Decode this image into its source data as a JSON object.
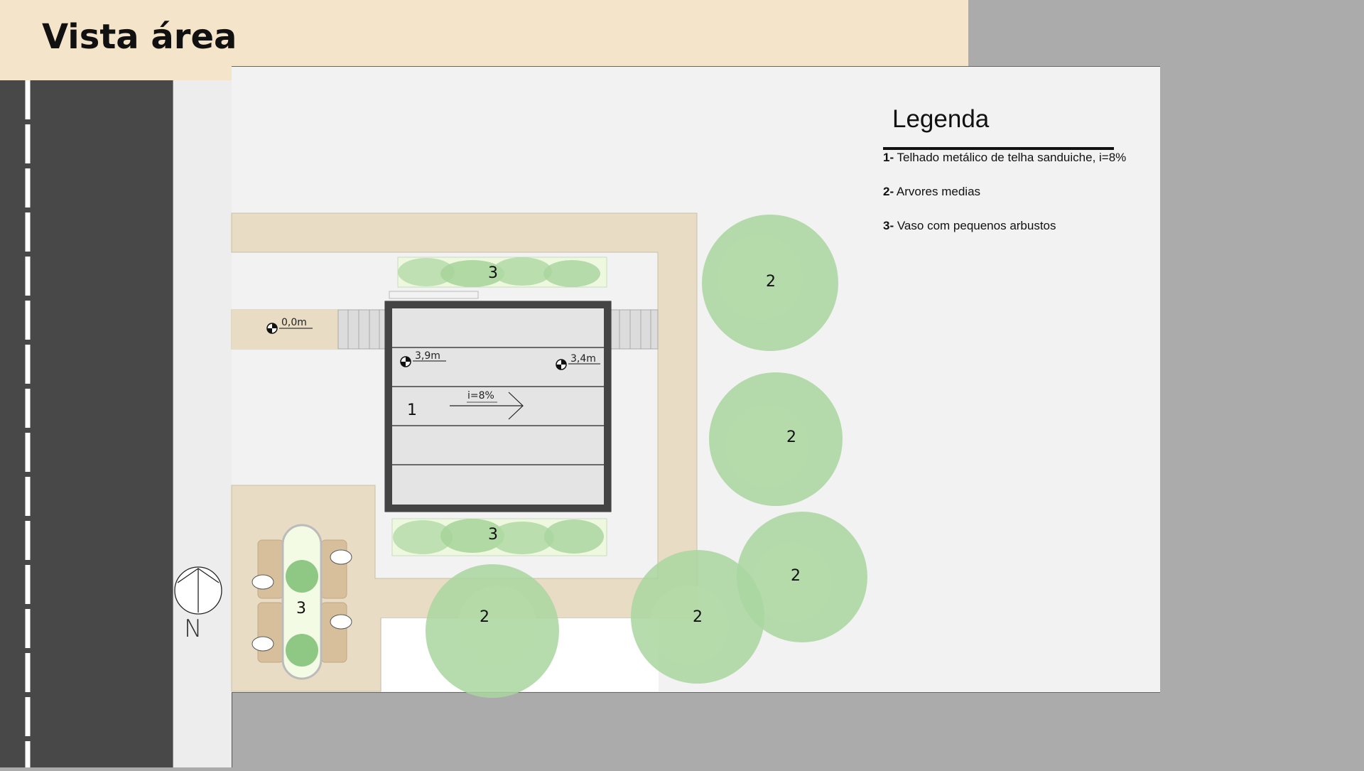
{
  "title": "Vista área",
  "legend": {
    "title": "Legenda",
    "items": [
      {
        "num": "1-",
        "text": "Telhado metálico de telha sanduiche, i=8%"
      },
      {
        "num": "2-",
        "text": "Arvores medias"
      },
      {
        "num": "3-",
        "text": "Vaso com pequenos arbustos"
      }
    ]
  },
  "plan": {
    "levels": [
      "0,0m",
      "3,9m",
      "3,4m"
    ],
    "slope": "i=8%",
    "roof_label": "1",
    "tree_label": "2",
    "planter_label": "3",
    "north": "N"
  },
  "colors": {
    "header_bg": "#f4e4ca",
    "road": "#484848",
    "paving": "#e8dcc4",
    "lot": "#f2f2f2",
    "tree": "#a9d6a0"
  }
}
